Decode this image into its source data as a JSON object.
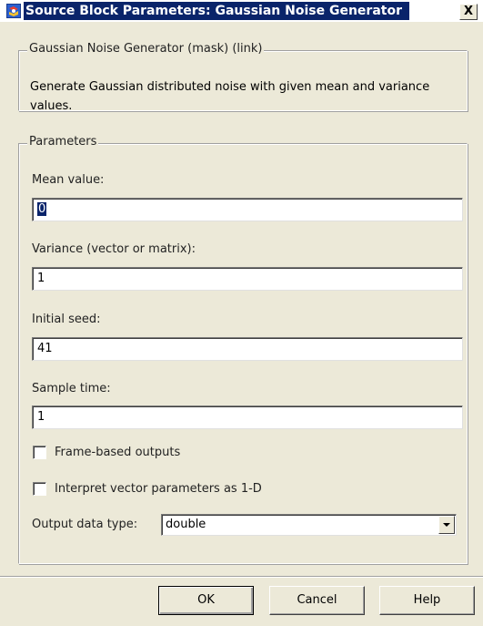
{
  "window": {
    "title": "Source Block Parameters: Gaussian Noise Generator",
    "close_label": "X"
  },
  "description_group": {
    "legend": "Gaussian Noise Generator (mask) (link)",
    "text": "Generate Gaussian distributed noise with given mean and variance values."
  },
  "parameters": {
    "legend": "Parameters",
    "mean": {
      "label": "Mean value:",
      "value": "0"
    },
    "variance": {
      "label": "Variance (vector or matrix):",
      "value": "1"
    },
    "seed": {
      "label": "Initial seed:",
      "value": "41"
    },
    "sample_time": {
      "label": "Sample time:",
      "value": "1"
    },
    "frame_based": {
      "label": "Frame-based outputs",
      "checked": false
    },
    "interpret_1d": {
      "label": "Interpret vector parameters as 1-D",
      "checked": false
    },
    "output_type": {
      "label": "Output data type:",
      "value": "double"
    }
  },
  "buttons": {
    "ok": "OK",
    "cancel": "Cancel",
    "help": "Help"
  },
  "colors": {
    "title_highlight": "#0a246a",
    "dialog_bg": "#ece9d8"
  }
}
